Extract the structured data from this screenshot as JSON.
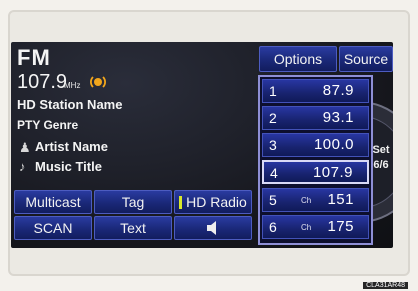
{
  "station": {
    "band": "FM",
    "frequency": "107.9",
    "unit": "MHz",
    "hd_station_name": "HD Station Name",
    "pty_genre": "PTY Genre",
    "artist": "Artist Name",
    "music_title": "Music Title"
  },
  "top_buttons": {
    "options": "Options",
    "source": "Source"
  },
  "controls": {
    "multicast": "Multicast",
    "tag": "Tag",
    "hd_radio": "HD Radio",
    "scan": "SCAN",
    "text": "Text"
  },
  "presets": [
    {
      "num": "1",
      "ch": "",
      "value": "87.9"
    },
    {
      "num": "2",
      "ch": "",
      "value": "93.1"
    },
    {
      "num": "3",
      "ch": "",
      "value": "100.0"
    },
    {
      "num": "4",
      "ch": "",
      "value": "107.9",
      "selected": true
    },
    {
      "num": "5",
      "ch": "Ch",
      "value": "151"
    },
    {
      "num": "6",
      "ch": "Ch",
      "value": "175"
    }
  ],
  "preset_set": {
    "label": "Set",
    "count": "6/6"
  },
  "image_code": "CLA31AR48",
  "colors": {
    "button_blue": "#1a2878",
    "accent_orange": "#f2a61c",
    "hd_indicator": "#d8e82a"
  },
  "icons": [
    "hd-radio-signal-icon",
    "artist-icon",
    "music-note-icon",
    "speaker-icon"
  ]
}
